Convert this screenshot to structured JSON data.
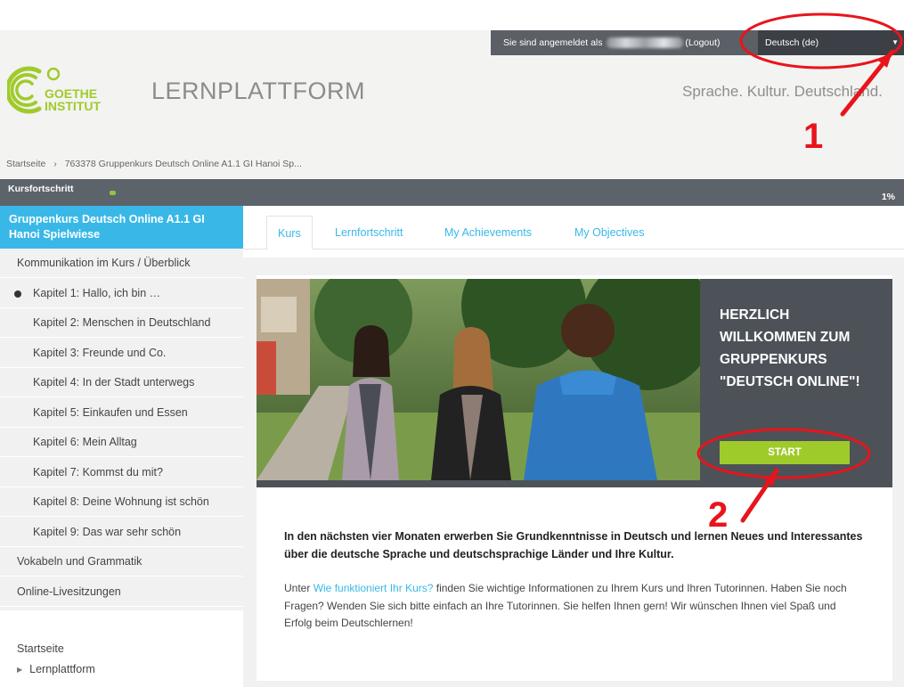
{
  "header": {
    "userbar_text": "Sie sind angemeldet als",
    "logout_label": "(Logout)",
    "language": "Deutsch (de)",
    "logo_line1": "GOETHE",
    "logo_line2": "INSTITUT",
    "platform_title": "LERNPLATTFORM",
    "slogan": "Sprache. Kultur. Deutschland."
  },
  "breadcrumb": {
    "home": "Startseite",
    "separator": "›",
    "current": "763378 Gruppenkurs Deutsch Online A1.1 GI Hanoi Sp..."
  },
  "progress": {
    "label": "Kursfortschritt",
    "percent": "1%",
    "value": 0.01
  },
  "sidebar": {
    "course_title": "Gruppenkurs Deutsch Online A1.1 GI Hanoi Spielwiese",
    "items": [
      {
        "label": "Kommunikation im Kurs / Überblick",
        "level": "top"
      },
      {
        "label": "Kapitel 1: Hallo, ich bin …",
        "level": "sub",
        "current": true
      },
      {
        "label": "Kapitel 2: Menschen in Deutschland",
        "level": "sub"
      },
      {
        "label": "Kapitel 3: Freunde und Co.",
        "level": "sub"
      },
      {
        "label": "Kapitel 4: In der Stadt unterwegs",
        "level": "sub"
      },
      {
        "label": "Kapitel 5: Einkaufen und Essen",
        "level": "sub"
      },
      {
        "label": "Kapitel 6: Mein Alltag",
        "level": "sub"
      },
      {
        "label": "Kapitel 7: Kommst du mit?",
        "level": "sub"
      },
      {
        "label": "Kapitel 8: Deine Wohnung ist schön",
        "level": "sub"
      },
      {
        "label": "Kapitel 9: Das war sehr schön",
        "level": "sub"
      },
      {
        "label": "Vokabeln und Grammatik",
        "level": "top"
      },
      {
        "label": "Online-Livesitzungen",
        "level": "top"
      }
    ],
    "footer_home": "Startseite",
    "footer_platform": "Lernplattform"
  },
  "tabs": [
    {
      "label": "Kurs",
      "active": true
    },
    {
      "label": "Lernfortschritt",
      "active": false
    },
    {
      "label": "My Achievements",
      "active": false
    },
    {
      "label": "My Objectives",
      "active": false
    }
  ],
  "banner": {
    "title": "HERZLICH WILLKOMMEN ZUM GRUPPENKURS \"DEUTSCH ONLINE\"!",
    "start_label": "START"
  },
  "content": {
    "intro_bold": "In den nächsten vier Monaten erwerben Sie Grundkenntnisse in Deutsch und lernen Neues und Interessantes über die deutsche Sprache und deutschsprachige Länder und Ihre Kultur.",
    "text_before_link": "Unter ",
    "link_text": "Wie funktioniert Ihr Kurs?",
    "text_after_link": " finden Sie wichtige Informationen zu Ihrem Kurs und Ihren Tutorinnen. Haben Sie noch Fragen? Wenden Sie sich bitte einfach an Ihre Tutorinnen. Sie helfen Ihnen gern! Wir wünschen Ihnen viel Spaß und Erfolg beim Deutschlernen!"
  },
  "annotations": {
    "marker1": "1",
    "marker2": "2",
    "color": "#e8141c"
  },
  "colors": {
    "accent_blue": "#39b8e8",
    "goethe_green": "#9fcb2a",
    "dark_bar": "#5d636a"
  }
}
